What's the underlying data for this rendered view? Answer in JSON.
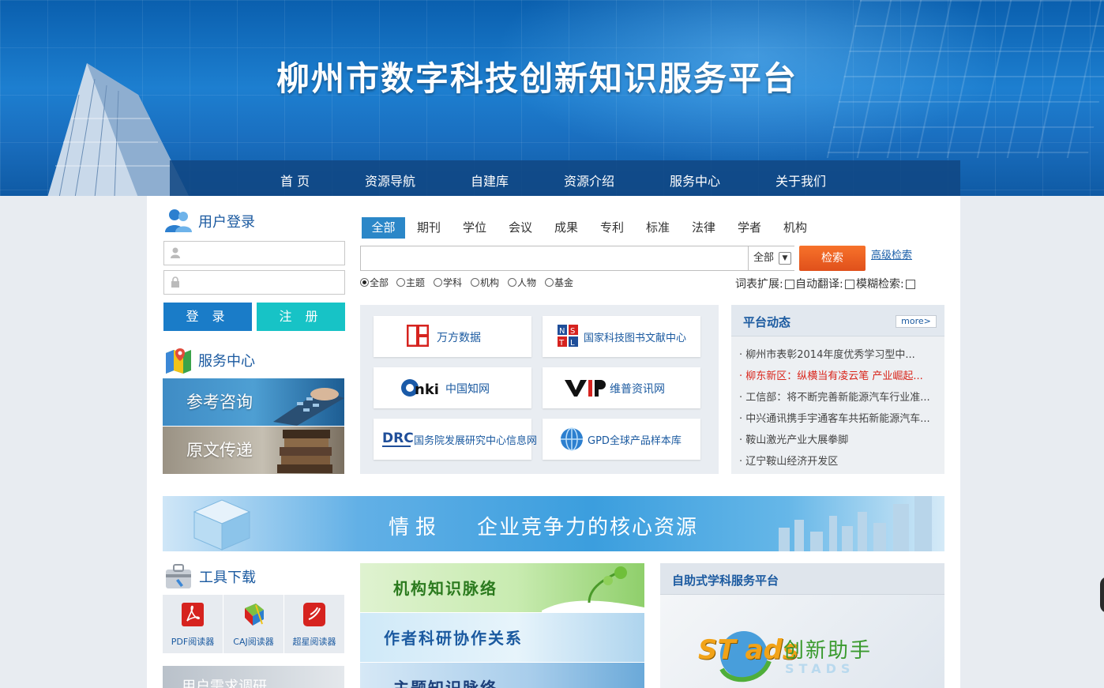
{
  "site": {
    "title": "柳州市数字科技创新知识服务平台"
  },
  "nav": [
    "首 页",
    "资源导航",
    "自建库",
    "资源介绍",
    "服务中心",
    "关于我们"
  ],
  "login": {
    "title": "用户登录",
    "login_label": "登 录",
    "register_label": "注 册"
  },
  "service": {
    "title": "服务中心",
    "items": [
      "参考咨询",
      "原文传递"
    ]
  },
  "search": {
    "tabs": [
      "全部",
      "期刊",
      "学位",
      "会议",
      "成果",
      "专利",
      "标准",
      "法律",
      "学者",
      "机构"
    ],
    "select_value": "全部",
    "button": "检索",
    "advanced": "高级检索",
    "radios": [
      "全部",
      "主题",
      "学科",
      "机构",
      "人物",
      "基金"
    ],
    "checks": [
      "词表扩展:",
      "自动翻译:",
      "模糊检索:"
    ]
  },
  "databases": [
    "万方数据",
    "国家科技图书文献中心",
    "中国知网",
    "维普资讯网",
    "国务院发展研究中心信息网",
    "GPD全球产品样本库"
  ],
  "news": {
    "title": "平台动态",
    "more": "more>",
    "items": [
      "· 柳州市表彰2014年度优秀学习型中...",
      "· 柳东新区：纵横当有凌云笔 产业崛起...",
      "· 工信部：将不断完善新能源汽车行业准...",
      "· 中兴通讯携手宇通客车共拓新能源汽车...",
      "· 鞍山激光产业大展拳脚",
      "· 辽宁鞍山经济开发区"
    ]
  },
  "ad": {
    "text1": "情报",
    "text2": "企业竞争力的核心资源"
  },
  "tools": {
    "title": "工具下载",
    "items": [
      "PDF阅读器",
      "CAJ阅读器",
      "超星阅读器"
    ]
  },
  "survey": "用户需求调研",
  "knowledge": [
    "机构知识脉络",
    "作者科研协作关系",
    "主题知识脉络"
  ],
  "selfsvc": {
    "title": "自助式学科服务平台",
    "brand": "创新助手",
    "brand_en": "STADS",
    "logo_text": "ST ads"
  },
  "colors": {
    "nav_bg": "#104682",
    "accent": "#1a7cc8",
    "register": "#17c3c6",
    "search_btn": "#e0501b"
  }
}
